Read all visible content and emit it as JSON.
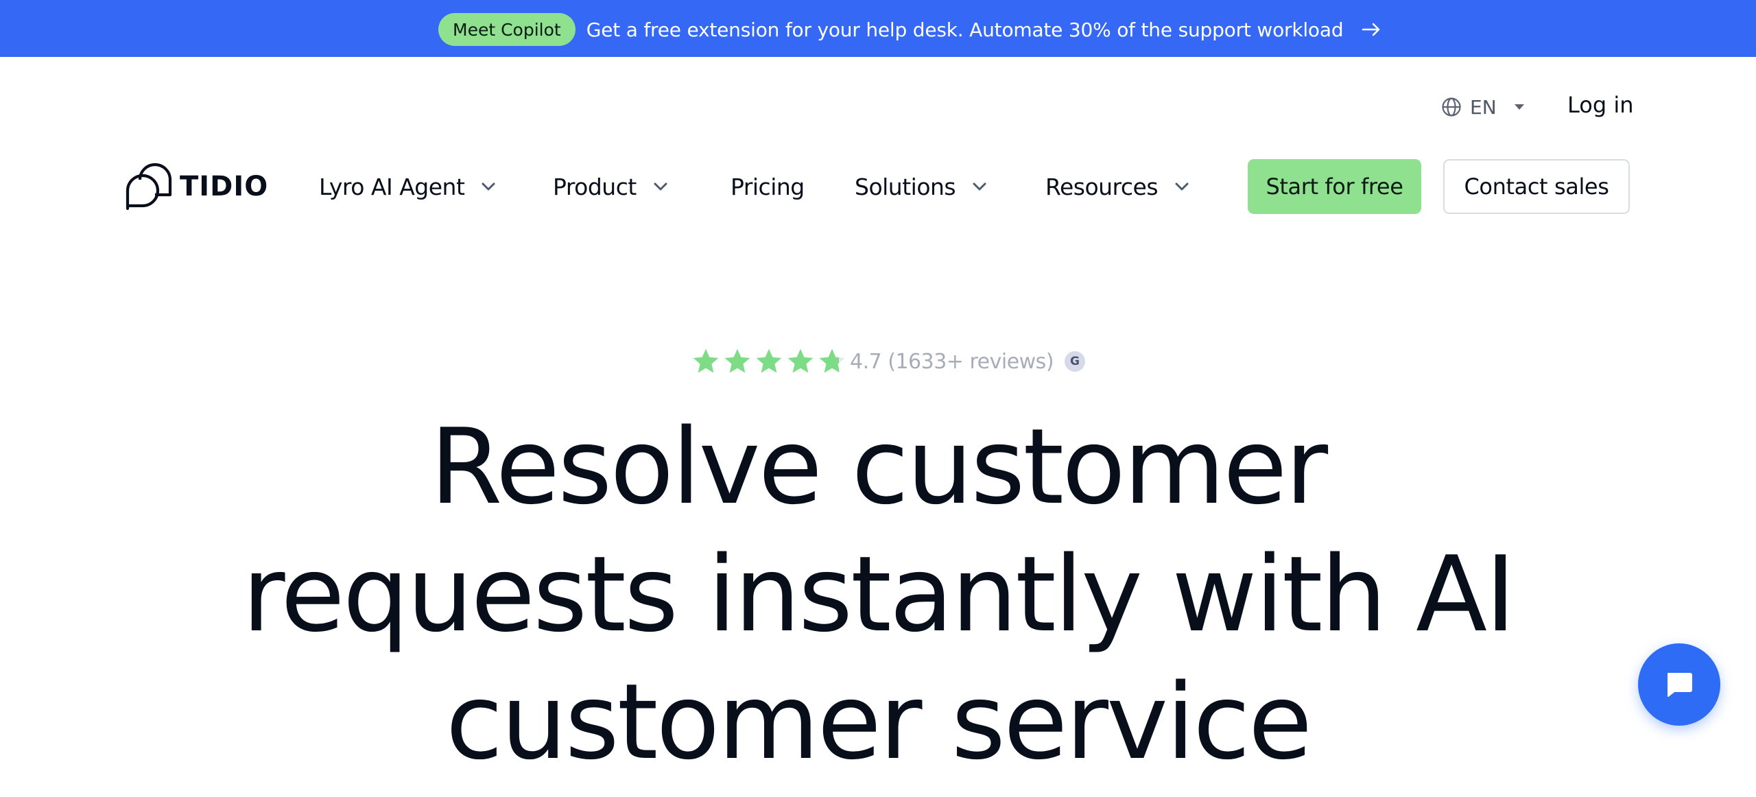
{
  "announcement": {
    "badge": "Meet Copilot",
    "text": "Get a free extension for your help desk. Automate 30% of the support workload",
    "arrow_icon": "arrow-right-icon"
  },
  "utility": {
    "language": "EN",
    "login": "Log in"
  },
  "nav": {
    "logo_text": "TIDIO",
    "items": [
      {
        "label": "Lyro AI Agent",
        "has_dropdown": true
      },
      {
        "label": "Product",
        "has_dropdown": true
      },
      {
        "label": "Pricing",
        "has_dropdown": false
      },
      {
        "label": "Solutions",
        "has_dropdown": true
      },
      {
        "label": "Resources",
        "has_dropdown": true
      }
    ],
    "cta_primary": "Start for free",
    "cta_secondary": "Contact sales"
  },
  "rating": {
    "score_text": "4.7 (1633+ reviews)",
    "stars_filled": 4.7,
    "stars_total": 5,
    "badge_letter": "G"
  },
  "hero": {
    "headline": "Resolve customer requests instantly with AI customer service"
  },
  "colors": {
    "brand_blue": "#3468f5",
    "accent_green": "#8fe08f",
    "text_dark": "#080f1a",
    "chat_blue": "#2f6cf6"
  }
}
